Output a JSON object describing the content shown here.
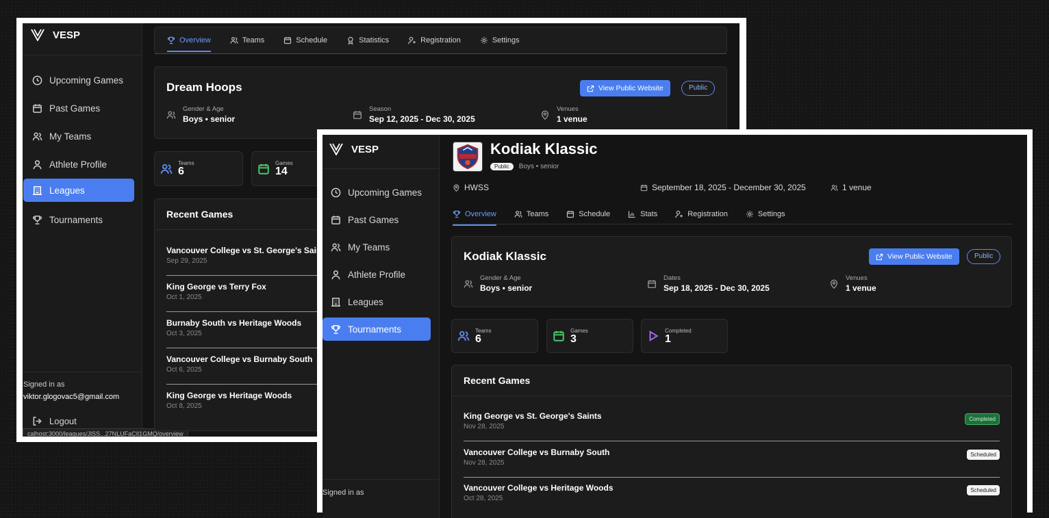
{
  "brand": "VESP",
  "sidebar_items": [
    "Upcoming Games",
    "Past Games",
    "My Teams",
    "Athlete Profile",
    "Leagues",
    "Tournaments"
  ],
  "signed_in_label": "Signed in as",
  "email": "viktor.glogovac5@gmail.com",
  "logout": "Logout",
  "status_url": "calhost:3000/leagues/JlSS...27NLUFaCIl1GMQ/overview",
  "league_window": {
    "tabs": [
      "Overview",
      "Teams",
      "Schedule",
      "Statistics",
      "Registration",
      "Settings"
    ],
    "title": "Dream Hoops",
    "view_public": "View Public Website",
    "public": "Public",
    "meta": [
      {
        "label": "Gender & Age",
        "value": "Boys • senior"
      },
      {
        "label": "Season",
        "value": "Sep 12, 2025 - Dec 30, 2025"
      },
      {
        "label": "Venues",
        "value": "1 venue"
      }
    ],
    "stats": [
      {
        "label": "Teams",
        "value": "6"
      },
      {
        "label": "Games",
        "value": "14"
      }
    ],
    "recent_games_title": "Recent Games",
    "games": [
      {
        "name": "Vancouver College vs St. George's Saints",
        "date": "Sep 29, 2025"
      },
      {
        "name": "King George vs Terry Fox",
        "date": "Oct 1, 2025"
      },
      {
        "name": "Burnaby South vs Heritage Woods",
        "date": "Oct 3, 2025"
      },
      {
        "name": "Vancouver College vs Burnaby South",
        "date": "Oct 6, 2025"
      },
      {
        "name": "King George vs Heritage Woods",
        "date": "Oct 8, 2025"
      }
    ]
  },
  "tournament_window": {
    "header_title": "Kodiak Klassic",
    "header_public": "Public",
    "header_division": "Boys • senior",
    "location": "HWSS",
    "date_range": "September 18, 2025 - December 30, 2025",
    "venue_count": "1 venue",
    "tabs": [
      "Overview",
      "Teams",
      "Schedule",
      "Stats",
      "Registration",
      "Settings"
    ],
    "card_title": "Kodiak Klassic",
    "view_public": "View Public Website",
    "public": "Public",
    "meta": [
      {
        "label": "Gender & Age",
        "value": "Boys • senior"
      },
      {
        "label": "Dates",
        "value": "Sep 18, 2025 - Dec 30, 2025"
      },
      {
        "label": "Venues",
        "value": "1 venue"
      }
    ],
    "stats": [
      {
        "label": "Teams",
        "value": "6"
      },
      {
        "label": "Games",
        "value": "3"
      },
      {
        "label": "Completed",
        "value": "1"
      }
    ],
    "recent_games_title": "Recent Games",
    "games": [
      {
        "name": "King George vs St. George's Saints",
        "date": "Nov 28, 2025",
        "status": "Completed"
      },
      {
        "name": "Vancouver College vs Burnaby South",
        "date": "Nov 28, 2025",
        "status": "Scheduled"
      },
      {
        "name": "Vancouver College vs Heritage Woods",
        "date": "Oct 28, 2025",
        "status": "Scheduled"
      }
    ]
  },
  "colors": {
    "accent": "#4a7ef0",
    "completed": "#3fae66",
    "games_icon": "#4cc96a",
    "completed_icon": "#a86bf5"
  }
}
